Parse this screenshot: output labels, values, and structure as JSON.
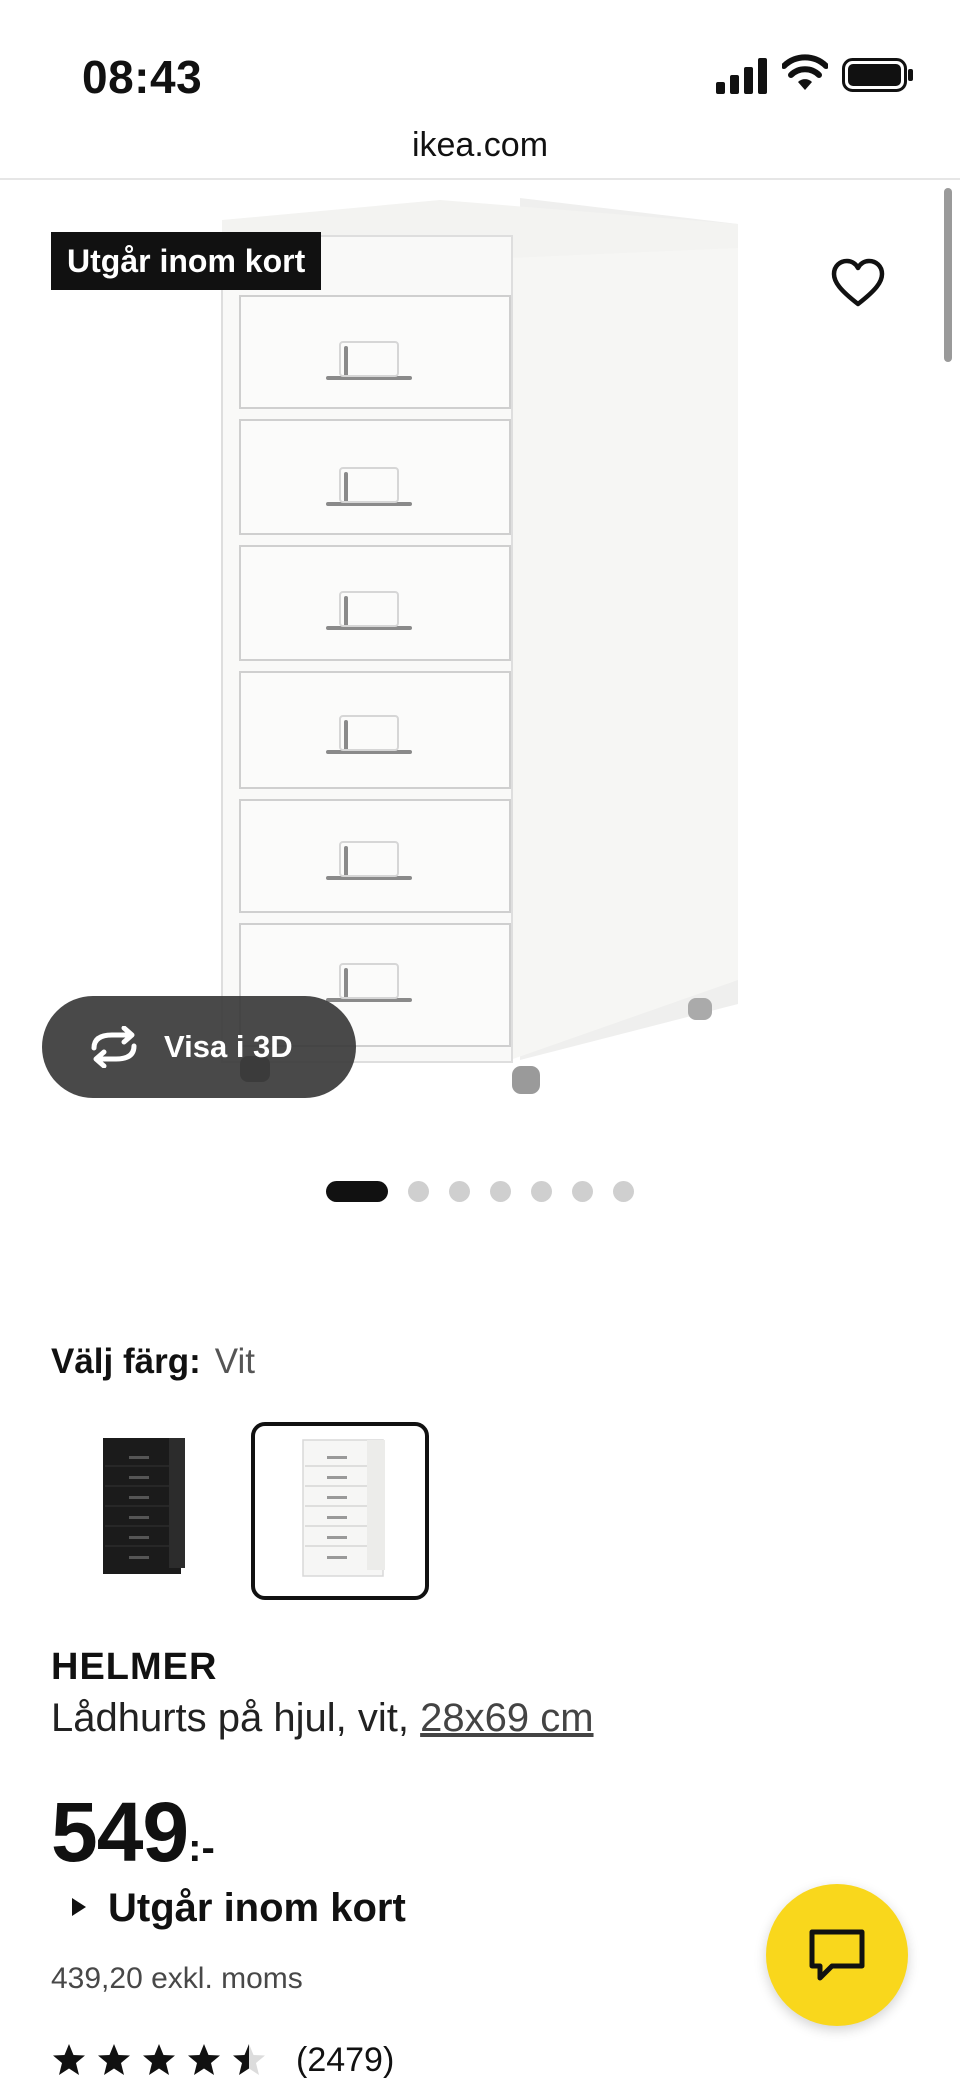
{
  "status_bar": {
    "time": "08:43"
  },
  "browser": {
    "url": "ikea.com"
  },
  "gallery": {
    "badge": "Utgår inom kort",
    "view_3d_label": "Visa i 3D",
    "dot_count": 7,
    "active_dot": 0
  },
  "color_selector": {
    "label": "Välj färg:",
    "selected": "Vit",
    "options": [
      "black",
      "white"
    ]
  },
  "product": {
    "name": "HELMER",
    "description": "Lådhurts på hjul, vit, ",
    "size": "28x69 cm",
    "price": "549",
    "price_suffix": ":-",
    "stock_status": "Utgår inom kort",
    "price_excl_vat": "439,20 exkl. moms",
    "rating": 4.5,
    "review_count": "(2479)"
  },
  "colors": {
    "accent_yellow": "#f9d71c",
    "badge_bg": "#111111"
  }
}
